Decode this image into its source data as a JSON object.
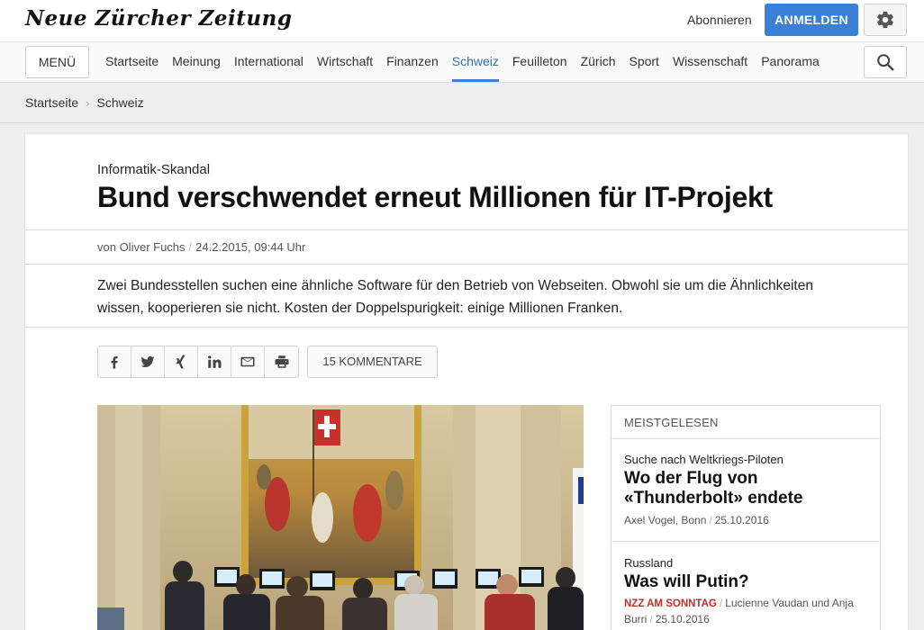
{
  "header": {
    "logo_text": "Neue Zürcher Zeitung",
    "subscribe_label": "Abonnieren",
    "login_label": "ANMELDEN",
    "settings_icon": "gear-icon"
  },
  "nav": {
    "menu_label": "MENÜ",
    "items": [
      "Startseite",
      "Meinung",
      "International",
      "Wirtschaft",
      "Finanzen",
      "Schweiz",
      "Feuilleton",
      "Zürich",
      "Sport",
      "Wissenschaft",
      "Panorama"
    ],
    "active": "Schweiz",
    "search_icon": "search-icon",
    "accent_color": "#3a80d9"
  },
  "breadcrumb": {
    "items": [
      "Startseite",
      "Schweiz"
    ]
  },
  "article": {
    "kicker": "Informatik-Skandal",
    "headline": "Bund verschwendet erneut Millionen für IT-Projekt",
    "author": "von Oliver Fuchs",
    "date": "24.2.2015, 09:44 Uhr",
    "lead": "Zwei Bundesstellen suchen eine ähnliche Software für den Betrieb von Webseiten. Obwohl sie um die Ähnlichkeiten wissen, kooperieren sie nicht. Kosten der Doppelspurigkeit: einige Millionen Franken.",
    "share_icons": [
      "facebook-icon",
      "twitter-icon",
      "xing-icon",
      "linkedin-icon",
      "email-icon",
      "print-icon"
    ],
    "comments_label": "15 KOMMENTARE"
  },
  "sidebar": {
    "title": "MEISTGELESEN",
    "items": [
      {
        "kicker": "Suche nach Weltkriegs-Piloten",
        "headline_line1": "Wo der Flug von",
        "headline_line2": "«Thunderbolt» endete",
        "author": "Axel Vogel, Bonn",
        "date": "25.10.2016"
      },
      {
        "kicker": "Russland",
        "headline_line1": "Was will Putin?",
        "tag": "NZZ AM SONNTAG",
        "author_line1": "Lucienne Vaudan und Anja",
        "author_line2": "Burri",
        "date": "25.10.2016",
        "tag_color": "#c0302a"
      }
    ]
  }
}
